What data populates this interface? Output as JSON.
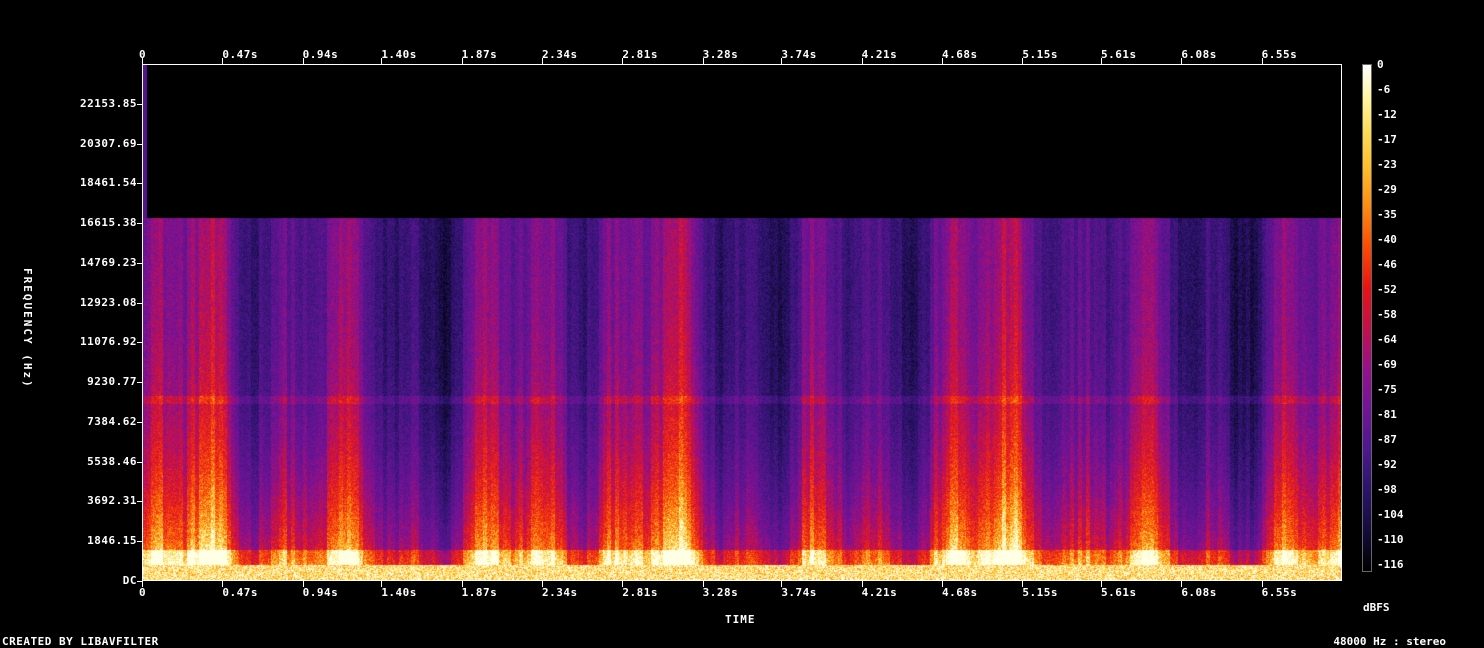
{
  "footer": {
    "created_by": "CREATED BY LIBAVFILTER",
    "audio_info": "48000 Hz : stereo"
  },
  "chart_data": {
    "type": "heatmap",
    "title": "",
    "xlabel": "TIME",
    "ylabel": "FREQUENCY (Hz)",
    "colorbar_label": "dBFS",
    "x_ticks": [
      "0",
      "0.47s",
      "0.94s",
      "1.40s",
      "1.87s",
      "2.34s",
      "2.81s",
      "3.28s",
      "3.74s",
      "4.21s",
      "4.68s",
      "5.15s",
      "5.61s",
      "6.08s",
      "6.55s"
    ],
    "x_tick_values": [
      0,
      0.47,
      0.94,
      1.4,
      1.87,
      2.34,
      2.81,
      3.28,
      3.74,
      4.21,
      4.68,
      5.15,
      5.61,
      6.08,
      6.55
    ],
    "xlim": [
      0,
      7.02
    ],
    "y_ticks": [
      "DC",
      "1846.15",
      "3692.31",
      "5538.46",
      "7384.62",
      "9230.77",
      "11076.92",
      "12923.08",
      "14769.23",
      "16615.38",
      "18461.54",
      "20307.69",
      "22153.85"
    ],
    "y_tick_values": [
      0,
      1846.15,
      3692.31,
      5538.46,
      7384.62,
      9230.77,
      11076.92,
      12923.08,
      14769.23,
      16615.38,
      18461.54,
      20307.69,
      22153.85
    ],
    "ylim": [
      0,
      24000
    ],
    "colorbar_ticks": [
      "0",
      "-6",
      "-12",
      "-17",
      "-23",
      "-29",
      "-35",
      "-40",
      "-46",
      "-52",
      "-58",
      "-64",
      "-69",
      "-75",
      "-81",
      "-87",
      "-92",
      "-98",
      "-104",
      "-110",
      "-116"
    ],
    "colorbar_range": [
      -116,
      0
    ],
    "content_cutoff_hz": 16900,
    "colors": {
      "background": "#000000",
      "low": "#2a1468",
      "mid": "#98108c",
      "high": "#ea1212",
      "peak": "#ffe060"
    }
  }
}
